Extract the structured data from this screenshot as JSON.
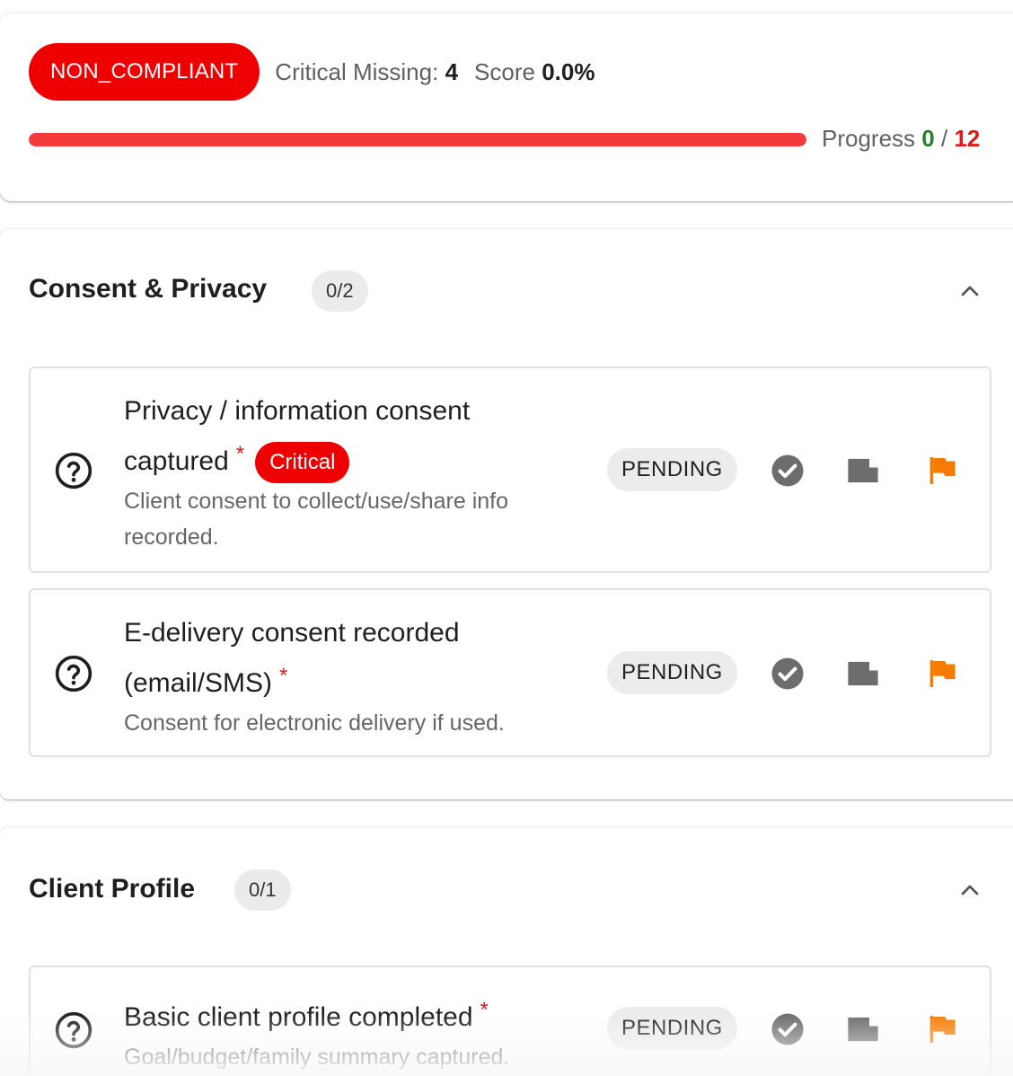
{
  "summary": {
    "status": "NON_COMPLIANT",
    "critical_missing_label": "Critical Missing:",
    "critical_missing_value": "4",
    "score_label": "Score",
    "score_value": "0.0%",
    "progress_label": "Progress",
    "progress_done": "0",
    "progress_separator": "/",
    "progress_total": "12",
    "progress_fraction": 0.0
  },
  "colors": {
    "danger": "#ef0000",
    "progress_bar": "#f43a3a",
    "progress_done": "#2e7d32",
    "flag": "#f57c00",
    "icon_gray": "#6d6d6d"
  },
  "sections": [
    {
      "title": "Consent & Privacy",
      "count": "0/2",
      "items": [
        {
          "title": "Privacy / information consent captured",
          "required_mark": "*",
          "badge": "Critical",
          "description": "Client consent to collect/use/share info recorded.",
          "status": "PENDING",
          "icons": [
            "help-circle-icon",
            "check-circle-icon",
            "note-icon",
            "flag-icon"
          ]
        },
        {
          "title": "E-delivery consent recorded (email/SMS)",
          "required_mark": "*",
          "description": "Consent for electronic delivery if used.",
          "status": "PENDING",
          "icons": [
            "help-circle-icon",
            "check-circle-icon",
            "note-icon",
            "flag-icon"
          ]
        }
      ]
    },
    {
      "title": "Client Profile",
      "count": "0/1",
      "items": [
        {
          "title": "Basic client profile completed",
          "required_mark": "*",
          "description": "Goal/budget/family summary captured.",
          "status": "PENDING",
          "icons": [
            "help-circle-icon",
            "check-circle-icon",
            "note-icon",
            "flag-icon"
          ]
        }
      ]
    }
  ]
}
